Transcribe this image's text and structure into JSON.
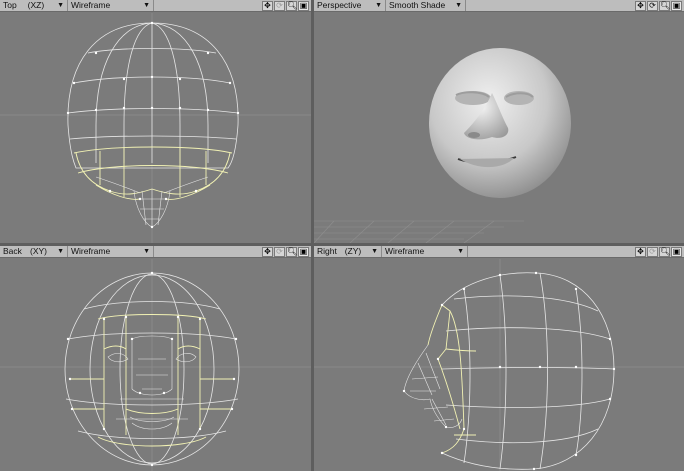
{
  "viewports": {
    "top": {
      "view": "Top",
      "axes": "(XZ)",
      "mode": "Wireframe"
    },
    "persp": {
      "view": "Perspective",
      "axes": "",
      "mode": "Smooth Shade"
    },
    "back": {
      "view": "Back",
      "axes": "(XY)",
      "mode": "Wireframe"
    },
    "right": {
      "view": "Right",
      "axes": "(ZY)",
      "mode": "Wireframe"
    }
  },
  "tools": {
    "move": "✥",
    "rotate": "⟳",
    "zoom": "🔍︎",
    "maximize": "▣"
  },
  "colors": {
    "viewport_bg": "#7b7b7b",
    "wire": "#e6e6e6",
    "selected_wire": "#f2f2b4",
    "header_bg": "#bdbdbd"
  }
}
